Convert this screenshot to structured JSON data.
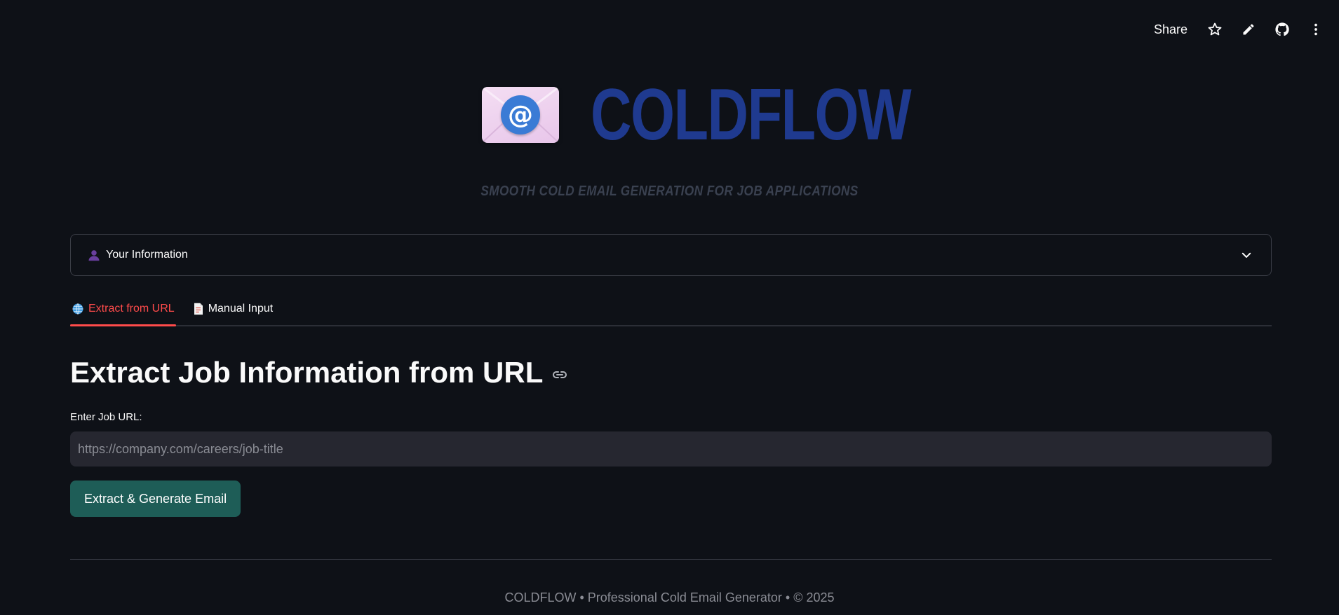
{
  "toolbar": {
    "share_label": "Share",
    "icons": [
      "star-icon",
      "pencil-icon",
      "github-icon",
      "more-vertical-icon"
    ]
  },
  "hero": {
    "logo_icon": "email-at-icon",
    "logo_glyph": "@",
    "brand": "COLDFLOW",
    "tagline": "SMOOTH COLD EMAIL GENERATION FOR JOB APPLICATIONS"
  },
  "expander": {
    "icon": "user-icon",
    "label": "Your Information"
  },
  "tabs": [
    {
      "icon": "globe-icon",
      "label": "Extract from URL",
      "active": true
    },
    {
      "icon": "document-icon",
      "label": "Manual Input",
      "active": false
    }
  ],
  "main": {
    "title": "Extract Job Information from URL",
    "url_label": "Enter Job URL:",
    "url_value": "",
    "url_placeholder": "https://company.com/careers/job-title",
    "submit_label": "Extract & Generate Email"
  },
  "footer": {
    "text": "COLDFLOW • Professional Cold Email Generator • © 2025"
  },
  "colors": {
    "background": "#0e1117",
    "brand": "#1f3a8f",
    "accent_tab": "#ff4b4b",
    "primary_button": "#1e5d57",
    "input_bg": "#262730"
  }
}
